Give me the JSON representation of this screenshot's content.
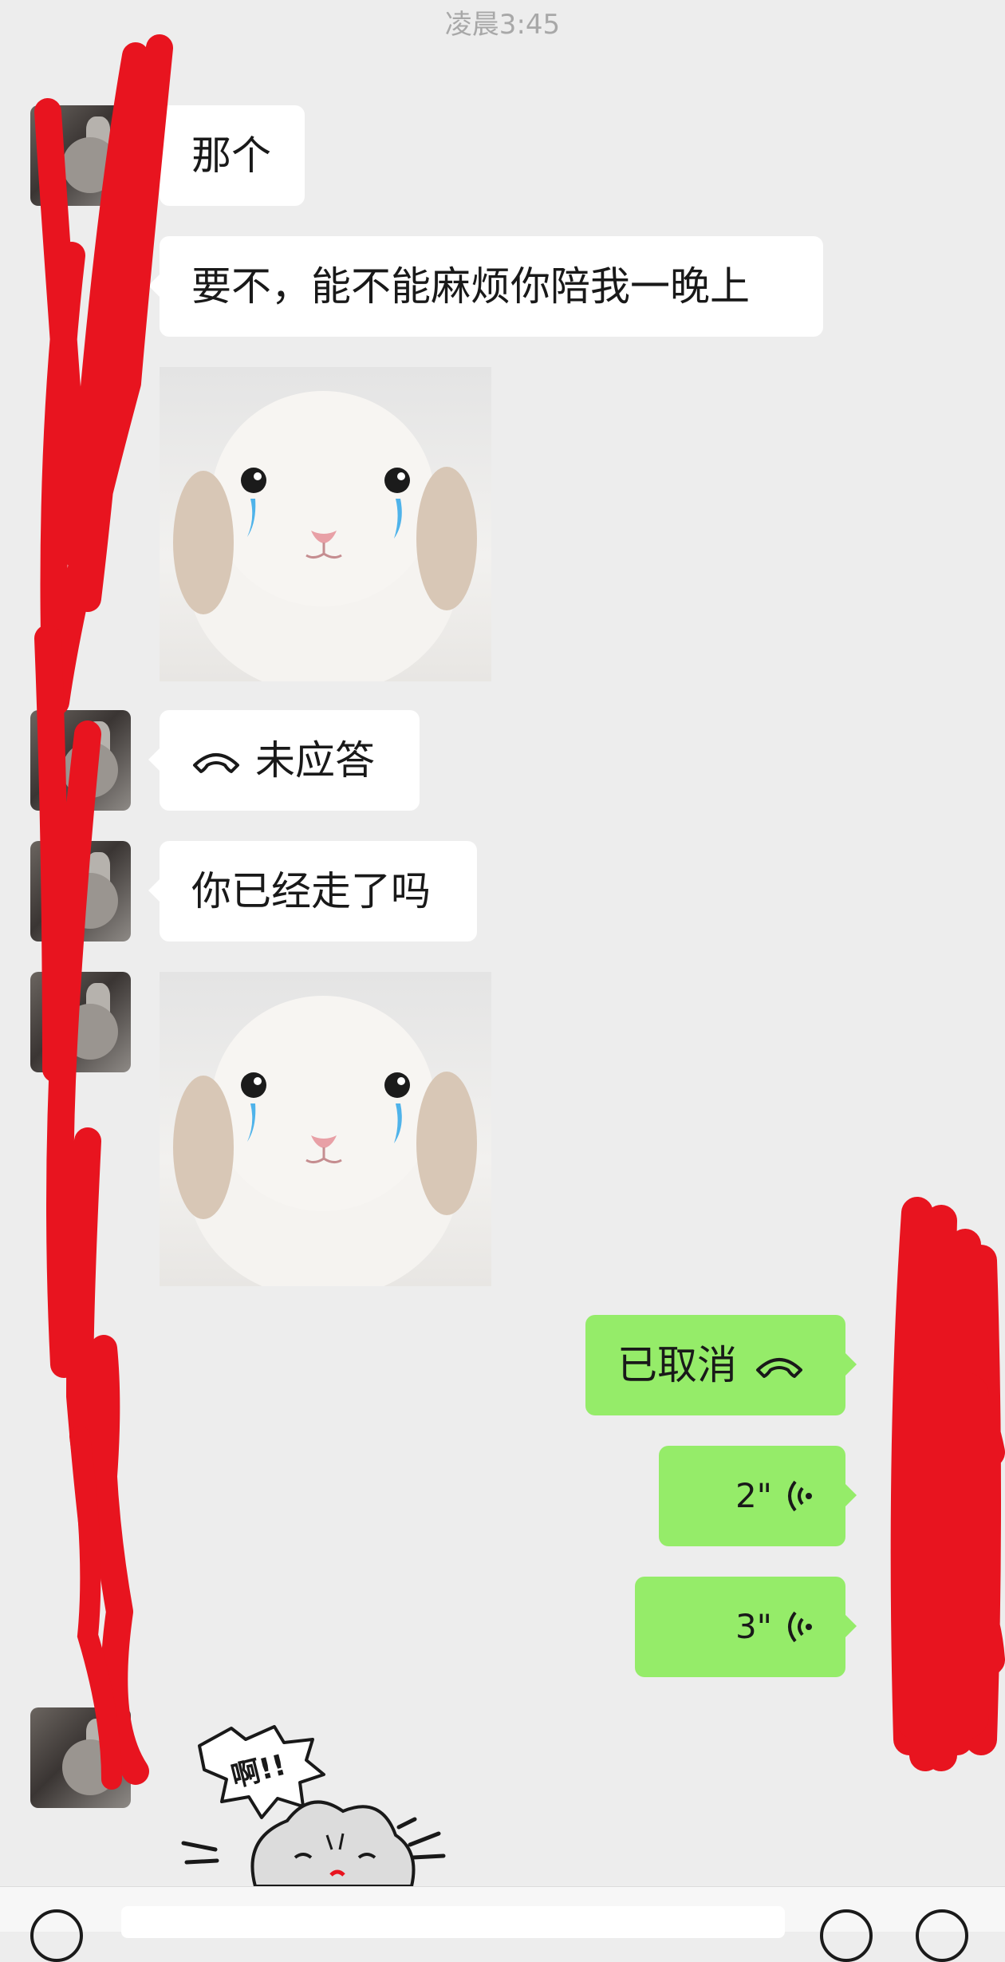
{
  "timestamp": "凌晨3:45",
  "messages": {
    "m1": {
      "text": "那个"
    },
    "m2": {
      "text": "要不，能不能麻烦你陪我一晚上"
    },
    "m3": {
      "sticker": "crying-bunny"
    },
    "m4": {
      "icon": "phone-hangup-icon",
      "text": "未应答"
    },
    "m5": {
      "text": "你已经走了吗"
    },
    "m6": {
      "sticker": "crying-bunny"
    },
    "m7": {
      "text": "已取消",
      "icon": "phone-hangup-icon"
    },
    "m8": {
      "duration": "2\"",
      "icon": "voice-wave-icon"
    },
    "m9": {
      "duration": "3\"",
      "icon": "voice-wave-icon"
    },
    "m10": {
      "sticker": "cartoon-bunny-shout",
      "sticker_text": "啊!!"
    }
  },
  "colors": {
    "background": "#ededed",
    "incoming_bubble": "#ffffff",
    "outgoing_bubble": "#95ec69",
    "redaction": "#e8141f"
  }
}
